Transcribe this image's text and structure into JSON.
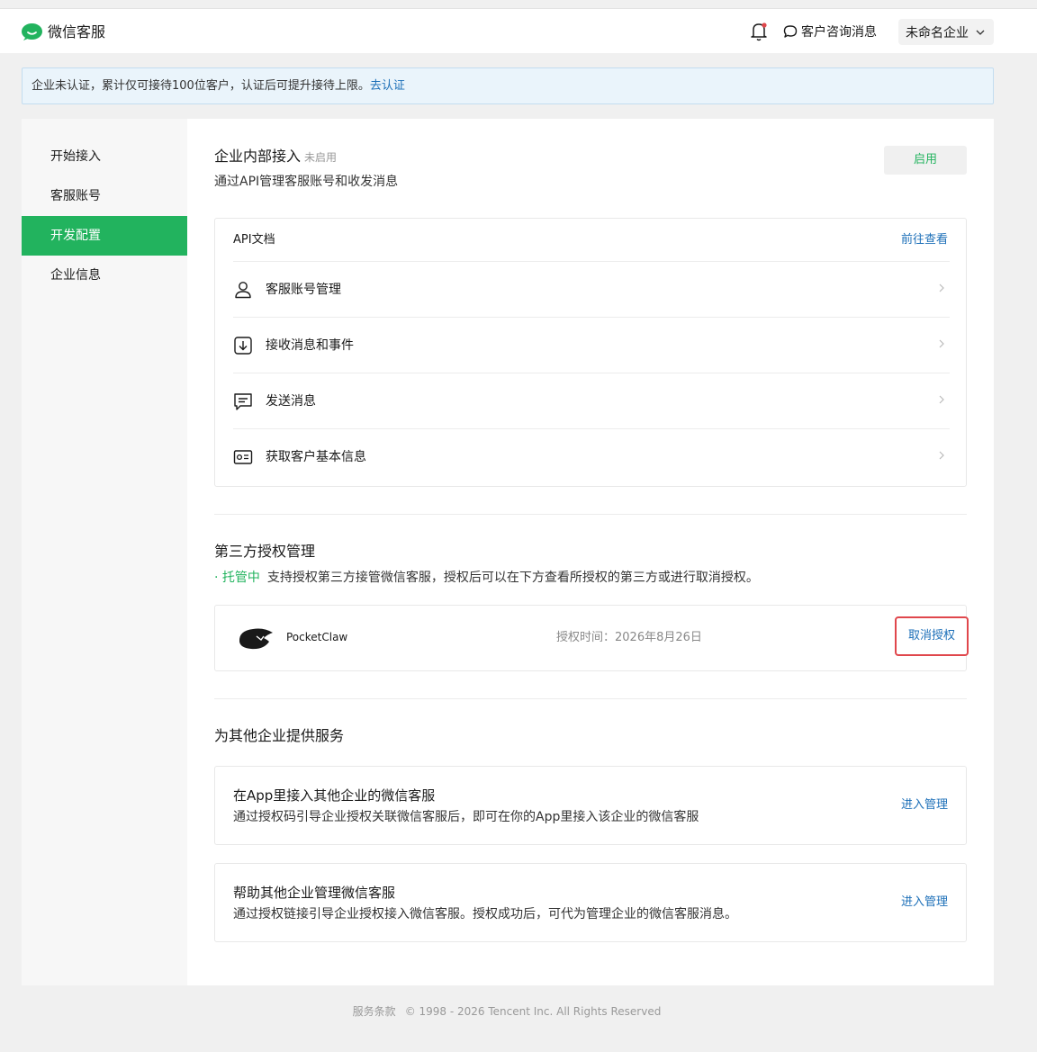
{
  "header": {
    "brand": "微信客服",
    "consult_label": "客户咨询消息",
    "corp_name": "未命名企业",
    "colors": {
      "brand_green": "#22b35e",
      "notification_dot": "#e0474c"
    }
  },
  "notice": {
    "text": "企业未认证，累计仅可接待100位客户，认证后可提升接待上限。",
    "link": "去认证"
  },
  "sidebar": {
    "items": [
      {
        "label": "开始接入"
      },
      {
        "label": "客服账号"
      },
      {
        "label": "开发配置",
        "active": true
      },
      {
        "label": "企业信息"
      }
    ]
  },
  "internal": {
    "title": "企业内部接入",
    "tag": "未启用",
    "desc": "通过API管理客服账号和收发消息",
    "enable_button": "启用",
    "api_doc_label": "API文档",
    "api_doc_link": "前往查看",
    "rows": [
      {
        "label": "客服账号管理",
        "icon": "user-icon"
      },
      {
        "label": "接收消息和事件",
        "icon": "download-icon"
      },
      {
        "label": "发送消息",
        "icon": "message-icon"
      },
      {
        "label": "获取客户基本信息",
        "icon": "id-card-icon"
      }
    ]
  },
  "third_party": {
    "title": "第三方授权管理",
    "status": "· 托管中",
    "desc": "支持授权第三方接管微信客服，授权后可以在下方查看所授权的第三方或进行取消授权。",
    "app_name": "PocketClaw",
    "auth_time": "授权时间：2026年8月26日",
    "cancel_button": "取消授权"
  },
  "services": {
    "title": "为其他企业提供服务",
    "items": [
      {
        "title": "在App里接入其他企业的微信客服",
        "desc": "通过授权码引导企业授权关联微信客服后，即可在你的App里接入该企业的微信客服",
        "link": "进入管理"
      },
      {
        "title": "帮助其他企业管理微信客服",
        "desc": "通过授权链接引导企业授权接入微信客服。授权成功后，可代为管理企业的微信客服消息。",
        "link": "进入管理"
      }
    ]
  },
  "footer": {
    "terms": "服务条款",
    "copyright": "© 1998 - 2026 Tencent Inc. All Rights Reserved"
  }
}
